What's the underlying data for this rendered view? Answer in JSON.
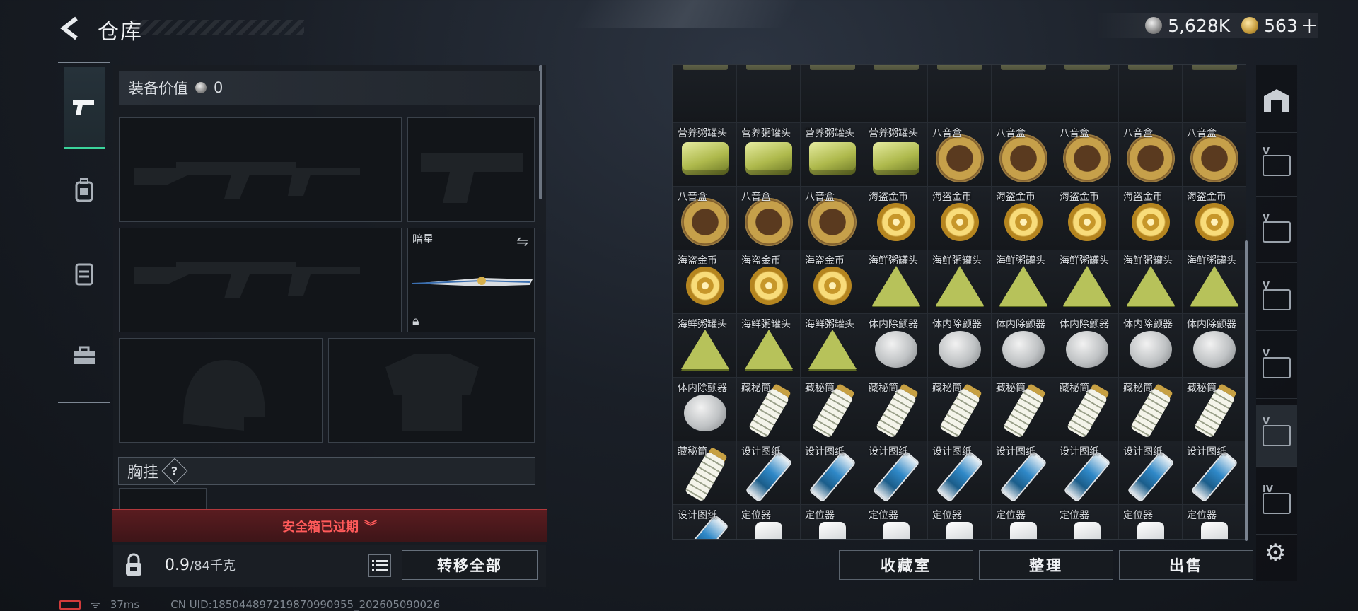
{
  "header": {
    "title": "仓库"
  },
  "currency": {
    "silver": "5,628K",
    "gold": "563",
    "gold_plus": "+"
  },
  "nav": {
    "items": [
      "weapons",
      "backpack",
      "vest",
      "toolkit"
    ]
  },
  "loadout": {
    "equip_value_label": "装备价值",
    "equip_value": "0",
    "melee_label": "暗星",
    "chest_label": "胸挂",
    "chest_help": "?",
    "warning": "安全箱已过期",
    "weight_current": "0.9",
    "weight_max": "/84千克",
    "transfer_label": "转移全部"
  },
  "status": {
    "ping": "37ms",
    "uid": "CN UID:185044897219870990955_202605090026"
  },
  "inventory": {
    "items": [
      {
        "label": "",
        "kind": "top"
      },
      {
        "label": "",
        "kind": "top"
      },
      {
        "label": "",
        "kind": "top"
      },
      {
        "label": "",
        "kind": "top"
      },
      {
        "label": "",
        "kind": "top"
      },
      {
        "label": "",
        "kind": "top"
      },
      {
        "label": "",
        "kind": "top"
      },
      {
        "label": "",
        "kind": "top"
      },
      {
        "label": "",
        "kind": "top"
      },
      {
        "label": "营养粥罐头",
        "kind": "can"
      },
      {
        "label": "营养粥罐头",
        "kind": "can"
      },
      {
        "label": "营养粥罐头",
        "kind": "can"
      },
      {
        "label": "营养粥罐头",
        "kind": "can"
      },
      {
        "label": "八音盒",
        "kind": "music"
      },
      {
        "label": "八音盒",
        "kind": "music"
      },
      {
        "label": "八音盒",
        "kind": "music"
      },
      {
        "label": "八音盒",
        "kind": "music"
      },
      {
        "label": "八音盒",
        "kind": "music"
      },
      {
        "label": "八音盒",
        "kind": "music"
      },
      {
        "label": "八音盒",
        "kind": "music"
      },
      {
        "label": "八音盒",
        "kind": "music"
      },
      {
        "label": "海盗金币",
        "kind": "coin"
      },
      {
        "label": "海盗金币",
        "kind": "coin"
      },
      {
        "label": "海盗金币",
        "kind": "coin"
      },
      {
        "label": "海盗金币",
        "kind": "coin"
      },
      {
        "label": "海盗金币",
        "kind": "coin"
      },
      {
        "label": "海盗金币",
        "kind": "coin"
      },
      {
        "label": "海盗金币",
        "kind": "coin"
      },
      {
        "label": "海盗金币",
        "kind": "coin"
      },
      {
        "label": "海盗金币",
        "kind": "coin"
      },
      {
        "label": "海鲜粥罐头",
        "kind": "seafood"
      },
      {
        "label": "海鲜粥罐头",
        "kind": "seafood"
      },
      {
        "label": "海鲜粥罐头",
        "kind": "seafood"
      },
      {
        "label": "海鲜粥罐头",
        "kind": "seafood"
      },
      {
        "label": "海鲜粥罐头",
        "kind": "seafood"
      },
      {
        "label": "海鲜粥罐头",
        "kind": "seafood"
      },
      {
        "label": "海鲜粥罐头",
        "kind": "seafood"
      },
      {
        "label": "海鲜粥罐头",
        "kind": "seafood"
      },
      {
        "label": "海鲜粥罐头",
        "kind": "seafood"
      },
      {
        "label": "体内除颤器",
        "kind": "remover"
      },
      {
        "label": "体内除颤器",
        "kind": "remover"
      },
      {
        "label": "体内除颤器",
        "kind": "remover"
      },
      {
        "label": "体内除颤器",
        "kind": "remover"
      },
      {
        "label": "体内除颤器",
        "kind": "remover"
      },
      {
        "label": "体内除颤器",
        "kind": "remover"
      },
      {
        "label": "体内除颤器",
        "kind": "remover"
      },
      {
        "label": "藏秘筒",
        "kind": "cache"
      },
      {
        "label": "藏秘筒",
        "kind": "cache"
      },
      {
        "label": "藏秘筒",
        "kind": "cache"
      },
      {
        "label": "藏秘筒",
        "kind": "cache"
      },
      {
        "label": "藏秘筒",
        "kind": "cache"
      },
      {
        "label": "藏秘筒",
        "kind": "cache"
      },
      {
        "label": "藏秘筒",
        "kind": "cache"
      },
      {
        "label": "藏秘筒",
        "kind": "cache"
      },
      {
        "label": "藏秘筒",
        "kind": "cache"
      },
      {
        "label": "设计图纸",
        "kind": "blueprint"
      },
      {
        "label": "设计图纸",
        "kind": "blueprint"
      },
      {
        "label": "设计图纸",
        "kind": "blueprint"
      },
      {
        "label": "设计图纸",
        "kind": "blueprint"
      },
      {
        "label": "设计图纸",
        "kind": "blueprint"
      },
      {
        "label": "设计图纸",
        "kind": "blueprint"
      },
      {
        "label": "设计图纸",
        "kind": "blueprint"
      },
      {
        "label": "设计图纸",
        "kind": "blueprint"
      },
      {
        "label": "设计图纸",
        "kind": "blueprint"
      },
      {
        "label": "定位器",
        "kind": "locator"
      },
      {
        "label": "定位器",
        "kind": "locator"
      },
      {
        "label": "定位器",
        "kind": "locator"
      },
      {
        "label": "定位器",
        "kind": "locator"
      },
      {
        "label": "定位器",
        "kind": "locator"
      },
      {
        "label": "定位器",
        "kind": "locator"
      },
      {
        "label": "定位器",
        "kind": "locator"
      },
      {
        "label": "定位器",
        "kind": "locator"
      }
    ],
    "buttons": {
      "collection": "收藏室",
      "organize": "整理",
      "sell": "出售"
    }
  },
  "rail": {
    "tabs": [
      {
        "name": "storage-tab",
        "tag": ""
      },
      {
        "name": "vault-tab-1",
        "tag": "V"
      },
      {
        "name": "vault-tab-2",
        "tag": "V"
      },
      {
        "name": "vault-tab-3",
        "tag": "V"
      },
      {
        "name": "vault-tab-4",
        "tag": "V"
      },
      {
        "name": "vault-tab-5",
        "tag": "V"
      },
      {
        "name": "vault-tab-6",
        "tag": "IV"
      }
    ]
  }
}
